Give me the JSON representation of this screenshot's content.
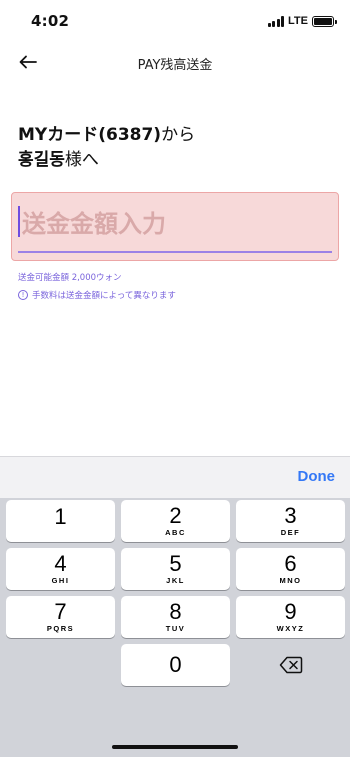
{
  "status": {
    "time": "4:02",
    "network": "LTE"
  },
  "header": {
    "title": "PAY残高送金",
    "back_icon": "arrow-left-icon"
  },
  "transfer": {
    "source_card": "MYカード(6387)",
    "source_suffix": "から",
    "recipient": "홍길동",
    "recipient_suffix": "様へ"
  },
  "amount": {
    "placeholder": "送金金額入力",
    "value": ""
  },
  "helper": {
    "limit": "送金可能金額 2,000ウォン",
    "fee_note": "手数料は送金金額によって異なります",
    "info_icon": "info-icon"
  },
  "keyboard": {
    "done_label": "Done",
    "keys": [
      {
        "num": "1",
        "letters": ""
      },
      {
        "num": "2",
        "letters": "ABC"
      },
      {
        "num": "3",
        "letters": "DEF"
      },
      {
        "num": "4",
        "letters": "GHI"
      },
      {
        "num": "5",
        "letters": "JKL"
      },
      {
        "num": "6",
        "letters": "MNO"
      },
      {
        "num": "7",
        "letters": "PQRS"
      },
      {
        "num": "8",
        "letters": "TUV"
      },
      {
        "num": "9",
        "letters": "WXYZ"
      },
      {
        "num": "0",
        "letters": ""
      }
    ],
    "delete_icon": "backspace-icon"
  },
  "colors": {
    "accent": "#7a64dc",
    "error_bg": "#f7d9d9",
    "done": "#3478f6"
  }
}
